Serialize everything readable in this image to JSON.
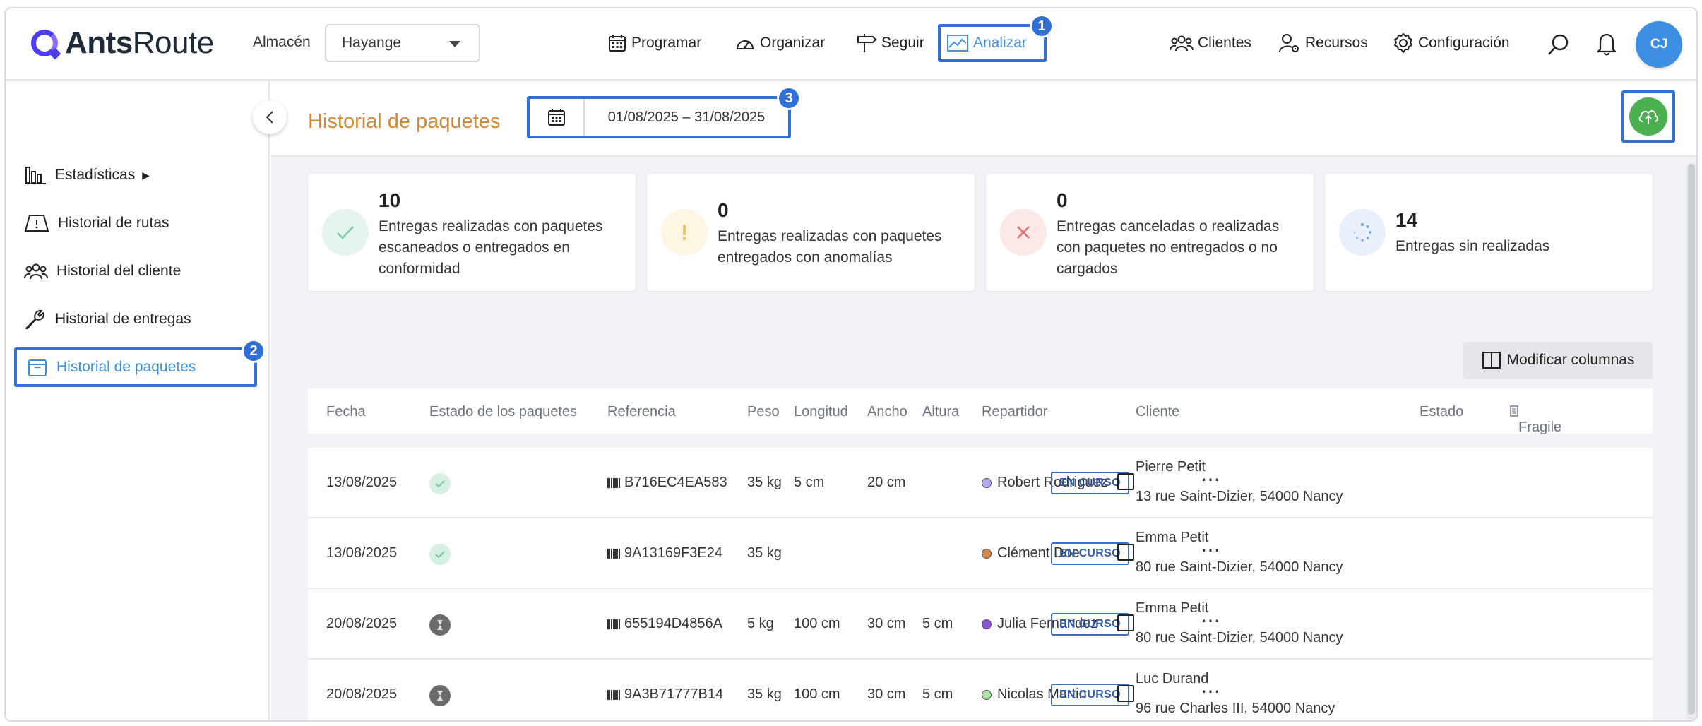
{
  "app": {
    "brand_bold": "Ants",
    "brand_rest": "Route"
  },
  "warehouse": {
    "label": "Almacén",
    "value": "Hayange"
  },
  "nav": {
    "programar": "Programar",
    "organizar": "Organizar",
    "seguir": "Seguir",
    "analizar": "Analizar",
    "clientes": "Clientes",
    "recursos": "Recursos",
    "configuracion": "Configuración"
  },
  "user": {
    "initials": "CJ"
  },
  "callouts": {
    "one": "1",
    "two": "2",
    "three": "3"
  },
  "sidebar": {
    "items": [
      {
        "label": "Estadísticas",
        "arrow": "▶"
      },
      {
        "label": "Historial de rutas"
      },
      {
        "label": "Historial del cliente"
      },
      {
        "label": "Historial de entregas"
      },
      {
        "label": "Historial de paquetes"
      }
    ]
  },
  "page": {
    "title": "Historial de paquetes",
    "date_range": "01/08/2025 – 31/08/2025"
  },
  "cards": [
    {
      "count": "10",
      "text": "Entregas realizadas con paquetes escaneados o entregados en conformidad",
      "color": "#e6f4ee"
    },
    {
      "count": "0",
      "text": "Entregas realizadas con paquetes entregados con anomalías",
      "color": "#fdf6e3"
    },
    {
      "count": "0",
      "text": "Entregas canceladas o realizadas con paquetes no entregados o no cargados",
      "color": "#fde8e8"
    },
    {
      "count": "14",
      "text": "Entregas sin realizadas",
      "color": "#e8f0fb"
    }
  ],
  "table": {
    "modify_columns": "Modificar columnas",
    "headers": {
      "fecha": "Fecha",
      "estado_paquetes": "Estado de los paquetes",
      "referencia": "Referencia",
      "peso": "Peso",
      "longitud": "Longitud",
      "ancho": "Ancho",
      "altura": "Altura",
      "repartidor": "Repartidor",
      "cliente": "Cliente",
      "estado": "Estado",
      "fragile": "Fragile"
    },
    "rows": [
      {
        "fecha": "13/08/2025",
        "status": "ok",
        "ref": "B716EC4EA583",
        "peso": "35 kg",
        "longitud": "5 cm",
        "ancho": "20 cm",
        "altura": "",
        "driver": "Robert Rodriguez",
        "driver_color": "#b9a6f0",
        "client": "Pierre Petit",
        "address": "13 rue Saint-Dizier, 54000 Nancy",
        "estado": "EN CURSO"
      },
      {
        "fecha": "13/08/2025",
        "status": "ok",
        "ref": "9A13169F3E24",
        "peso": "35 kg",
        "longitud": "",
        "ancho": "",
        "altura": "",
        "driver": "Clément Doe",
        "driver_color": "#d58a4a",
        "client": "Emma Petit",
        "address": "80 rue Saint-Dizier, 54000 Nancy",
        "estado": "EN CURSO"
      },
      {
        "fecha": "20/08/2025",
        "status": "wait",
        "ref": "655194D4856A",
        "peso": "5 kg",
        "longitud": "100 cm",
        "ancho": "30 cm",
        "altura": "5 cm",
        "driver": "Julia Fernandez",
        "driver_color": "#8a55d6",
        "client": "Emma Petit",
        "address": "80 rue Saint-Dizier, 54000 Nancy",
        "estado": "EN CURSO"
      },
      {
        "fecha": "20/08/2025",
        "status": "wait",
        "ref": "9A3B71777B14",
        "peso": "35 kg",
        "longitud": "100 cm",
        "ancho": "30 cm",
        "altura": "5 cm",
        "driver": "Nicolas Martin",
        "driver_color": "#a7e3a0",
        "client": "Luc Durand",
        "address": "96 rue Charles III, 54000 Nancy",
        "estado": "EN CURSO"
      }
    ],
    "more": "⋯"
  }
}
